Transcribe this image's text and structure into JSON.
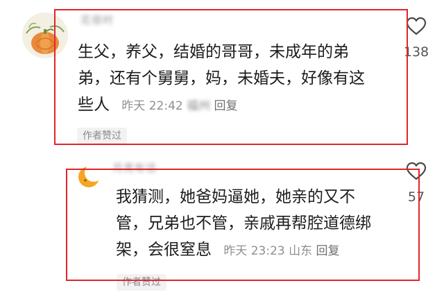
{
  "comments": [
    {
      "username": "花很时",
      "text_line1": "生父，养父，结婚的哥哥，未成年的弟",
      "text_line2": "弟，还有个舅舅，妈，未婚夫，好像有这",
      "text_line3": "些人",
      "time": "昨天 22:42",
      "location": "福州",
      "reply_label": "回复",
      "author_liked_label": "作者赞过",
      "like_count": "138",
      "avatar_icon": "pumpkin-avatar-icon",
      "like_icon": "heart-outline-icon",
      "highlight_color": "#e1242a"
    },
    {
      "username": "月亮有话",
      "text_line1": "我猜测，她爸妈逼她，她亲的又不",
      "text_line2": "管，兄弟也不管，亲戚再帮腔道德绑",
      "text_line3": "架，会很窒息",
      "time": "昨天 23:23",
      "location": "山东",
      "reply_label": "回复",
      "author_liked_label": "作者赞过",
      "like_count": "57",
      "avatar_icon": "crescent-moon-avatar-icon",
      "like_icon": "heart-outline-icon",
      "highlight_color": "#e1242a"
    }
  ]
}
